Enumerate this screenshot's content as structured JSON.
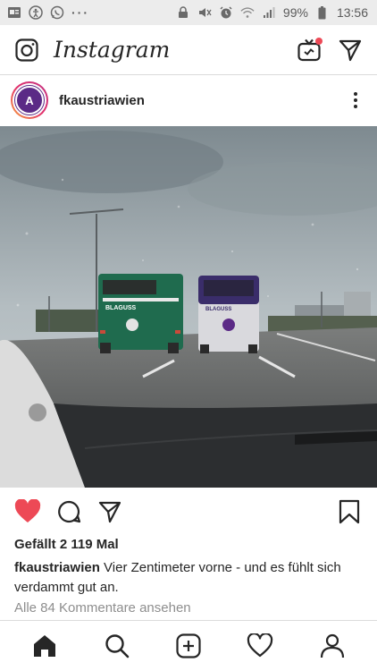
{
  "status_bar": {
    "left_icons": [
      "contacts-icon",
      "accessibility-icon",
      "whatsapp-icon",
      "more-dots"
    ],
    "more_dots": "···",
    "battery_percent": "99%",
    "time": "13:56"
  },
  "header": {
    "brand": "Instagram",
    "icons": [
      "camera-icon",
      "igtv-icon",
      "direct-message-icon"
    ],
    "igtv_notification_color": "#ed4956"
  },
  "post": {
    "avatar_text": "A",
    "username": "fkaustriawien",
    "likes_text": "Gefällt 2 119 Mal",
    "caption_user": "fkaustriawien",
    "caption_text": "Vier Zentimeter vorne - und es fühlt sich verdammt gut an.",
    "comments_link": "Alle 84 Kommentare ansehen",
    "like_color": "#ed4956",
    "bus_labels": {
      "left_brand": "BLAGUSS",
      "right_brand": "BLAGUSS"
    }
  },
  "nav": {
    "items": [
      "home-icon",
      "search-icon",
      "new-post-icon",
      "activity-icon",
      "profile-icon"
    ]
  }
}
